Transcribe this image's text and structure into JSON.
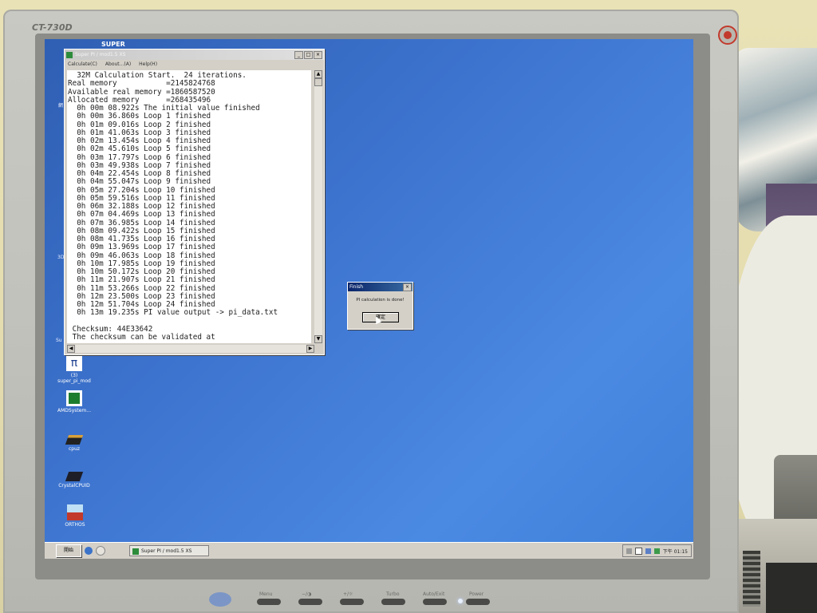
{
  "monitor": {
    "model": "CT-730D",
    "buttons": [
      "Menu",
      "−/◑",
      "+/☼",
      "Turbo",
      "Auto/Exit",
      "Power"
    ]
  },
  "desktop": {
    "top_label": "SUPER",
    "edge_labels": [
      "網",
      "3D",
      "Su"
    ],
    "icons": [
      {
        "label": "super_pi_mod",
        "sublabel": "(3)",
        "icon": "super-pi-icon"
      },
      {
        "label": "AMDSystem...",
        "icon": "amd-icon"
      },
      {
        "label": "cpuz",
        "icon": "chip-icon"
      },
      {
        "label": "CrystalCPUID",
        "icon": "chip-icon"
      },
      {
        "label": "ORTHOS",
        "icon": "orthos-icon"
      }
    ]
  },
  "superpi_window": {
    "title": "Super PI / mod1.5 XS",
    "menu": [
      "Calculate(C)",
      "About...(A)",
      "Help(H)"
    ],
    "log_lines": [
      "  32M Calculation Start.  24 iterations.",
      "Real memory           =2145824768",
      "Available real memory =1860587520",
      "Allocated memory      =268435496",
      "  0h 00m 08.922s The initial value finished",
      "  0h 00m 36.860s Loop 1 finished",
      "  0h 01m 09.016s Loop 2 finished",
      "  0h 01m 41.063s Loop 3 finished",
      "  0h 02m 13.454s Loop 4 finished",
      "  0h 02m 45.610s Loop 5 finished",
      "  0h 03m 17.797s Loop 6 finished",
      "  0h 03m 49.938s Loop 7 finished",
      "  0h 04m 22.454s Loop 8 finished",
      "  0h 04m 55.047s Loop 9 finished",
      "  0h 05m 27.204s Loop 10 finished",
      "  0h 05m 59.516s Loop 11 finished",
      "  0h 06m 32.188s Loop 12 finished",
      "  0h 07m 04.469s Loop 13 finished",
      "  0h 07m 36.985s Loop 14 finished",
      "  0h 08m 09.422s Loop 15 finished",
      "  0h 08m 41.735s Loop 16 finished",
      "  0h 09m 13.969s Loop 17 finished",
      "  0h 09m 46.063s Loop 18 finished",
      "  0h 10m 17.985s Loop 19 finished",
      "  0h 10m 50.172s Loop 20 finished",
      "  0h 11m 21.907s Loop 21 finished",
      "  0h 11m 53.266s Loop 22 finished",
      "  0h 12m 23.500s Loop 23 finished",
      "  0h 12m 51.704s Loop 24 finished",
      "  0h 13m 19.235s PI value output -> pi_data.txt",
      "",
      " Checksum: 44E33642",
      " The checksum can be validated at"
    ]
  },
  "finish_dialog": {
    "title": "Finish",
    "message": "PI calculation is done!",
    "ok_label": "確定"
  },
  "taskbar": {
    "start_label": "開始",
    "task_label": "Super PI / mod1.5 XS",
    "clock": "下午 01:15"
  }
}
